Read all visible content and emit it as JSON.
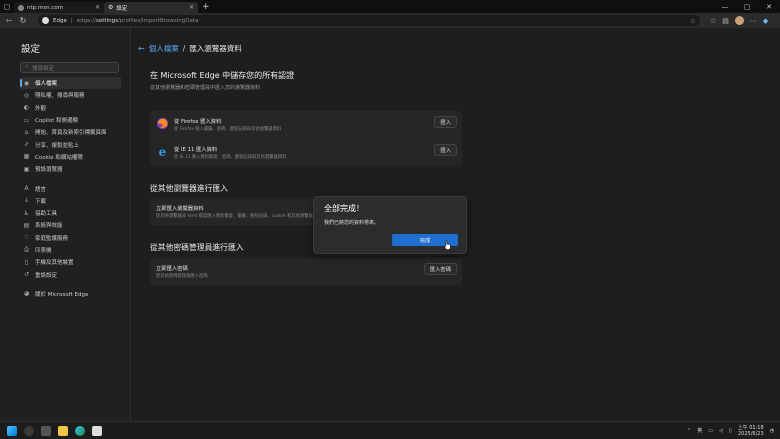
{
  "tabs": [
    {
      "label": "ntp.msn.com"
    },
    {
      "label": "設定"
    }
  ],
  "address": {
    "browser_label": "Edge",
    "url_prefix": "edge://",
    "url_host": "settings",
    "url_path": "/profiles/importBrowsingData"
  },
  "sidebar": {
    "title": "設定",
    "search_placeholder": "搜尋設定",
    "items": [
      {
        "label": "個人檔案",
        "icon": "person-icon"
      },
      {
        "label": "隱私權、搜尋與服務",
        "icon": "lock-icon"
      },
      {
        "label": "外觀",
        "icon": "palette-icon"
      },
      {
        "label": "Copilot 和側邊欄",
        "icon": "copilot-icon"
      },
      {
        "label": "開始、首頁及新索引標籤頁面",
        "icon": "home-icon"
      },
      {
        "label": "分享、複製並貼上",
        "icon": "share-icon"
      },
      {
        "label": "Cookie 和網站權限",
        "icon": "cookie-icon"
      },
      {
        "label": "預設瀏覽器",
        "icon": "browser-icon"
      },
      {
        "label": "語言",
        "icon": "language-icon"
      },
      {
        "label": "下載",
        "icon": "download-icon"
      },
      {
        "label": "協助工具",
        "icon": "accessibility-icon"
      },
      {
        "label": "系統與效能",
        "icon": "system-icon"
      },
      {
        "label": "家庭監護服務",
        "icon": "family-icon"
      },
      {
        "label": "印表機",
        "icon": "printer-icon"
      },
      {
        "label": "手機及其他裝置",
        "icon": "phone-icon"
      },
      {
        "label": "重設設定",
        "icon": "reset-icon"
      },
      {
        "label": "關於 Microsoft Edge",
        "icon": "edge-icon"
      }
    ]
  },
  "breadcrumb": {
    "parent": "個人檔案",
    "separator": "/",
    "current": "匯入瀏覽器資料"
  },
  "main": {
    "heading": "在 Microsoft Edge 中儲存您的所有認證",
    "subheading": "從其他瀏覽器和密碼管理員中匯入您的瀏覽器資料",
    "import_rows": [
      {
        "title": "從 Firefox 匯入資料",
        "desc": "從 Firefox 匯入書籤、密碼、歷程記錄和其他瀏覽器資料",
        "button": "匯入",
        "icon": "firefox-icon"
      },
      {
        "title": "從 IE 11 匯入資料",
        "desc": "從 IE 11 匯入我的最愛、密碼、歷程記錄和其他瀏覽器資料",
        "button": "匯入",
        "icon": "ie-icon"
      }
    ],
    "other_browsers": {
      "heading": "從其他瀏覽器進行匯入",
      "title": "立即匯入瀏覽器資料",
      "desc": "從其他瀏覽器或 html 檔案匯入我的最愛、書籤、歷程記錄、cookie 和其他瀏覽器資料"
    },
    "password_managers": {
      "heading": "從其他密碼管理員進行匯入",
      "title": "立即匯入密碼",
      "desc": "從其他密碼管理員匯入密碼",
      "button": "匯入密碼"
    }
  },
  "dialog": {
    "title": "全部完成！",
    "message": "我們已將您的資料帶來。",
    "ok_button": "完成"
  },
  "taskbar": {
    "lang": "英",
    "time": "上午 01:18",
    "date": "2025/6/23"
  },
  "colors": {
    "accent": "#5aa9f2",
    "primary_button": "#1f6fd1"
  }
}
